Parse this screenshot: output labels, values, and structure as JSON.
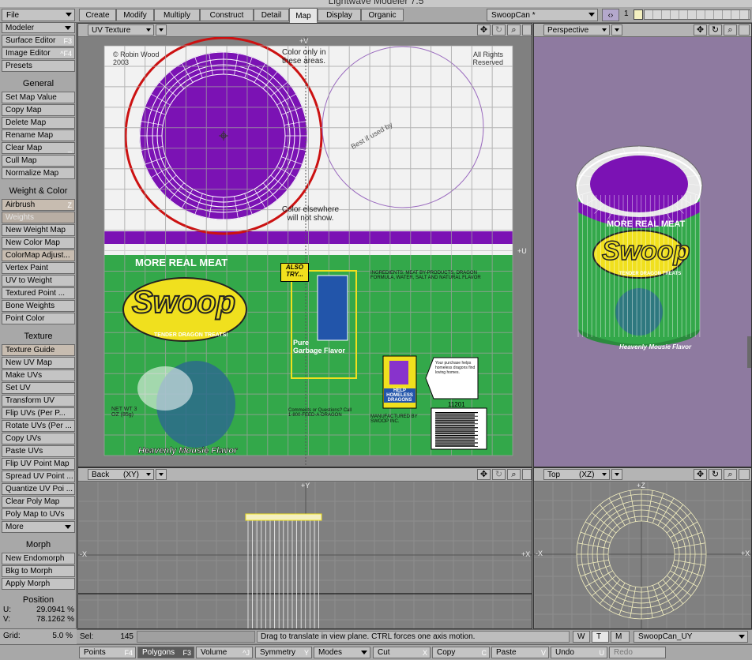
{
  "window": {
    "title": "Lightwave Modeler 7.5"
  },
  "menu": {
    "file": "File"
  },
  "tabs": [
    {
      "label": "Create"
    },
    {
      "label": "Modify"
    },
    {
      "label": "Multiply"
    },
    {
      "label": "Construct"
    },
    {
      "label": "Detail"
    },
    {
      "label": "Map"
    },
    {
      "label": "Display"
    },
    {
      "label": "Organic"
    }
  ],
  "object": {
    "name": "SwoopCan *"
  },
  "layer": {
    "number": "1"
  },
  "sidebar": {
    "mode": "Modeler",
    "top": [
      {
        "label": "Surface Editor",
        "shortcut": "F3"
      },
      {
        "label": "Image Editor",
        "shortcut": "^F4"
      },
      {
        "label": "Presets",
        "shortcut": ""
      }
    ],
    "general_title": "General",
    "general": [
      "Set Map Value",
      "Copy Map",
      "Delete Map",
      "Rename Map",
      "Clear Map",
      "Cull Map",
      "Normalize Map"
    ],
    "weight_title": "Weight & Color",
    "airbrush": {
      "label": "Airbrush",
      "shortcut": "Z"
    },
    "weights": "Weights",
    "weight_items": [
      "New Weight Map",
      "New Color Map",
      "ColorMap Adjust...",
      "Vertex Paint",
      "UV to Weight",
      "Textured Point ...",
      "Bone Weights",
      "Point Color"
    ],
    "texture_title": "Texture",
    "texture_guide": "Texture Guide",
    "texture_items": [
      "New UV Map",
      "Make UVs",
      "Set UV",
      "Transform UV",
      "Flip UVs (Per P...",
      "Rotate UVs (Per ...",
      "Copy UVs",
      "Paste UVs",
      "Flip UV Point Map",
      "Spread UV Point ...",
      "Quantize UV Poi ...",
      "Clear Poly Map",
      "Poly Map to UVs"
    ],
    "more": "More",
    "morph_title": "Morph",
    "morph_items": [
      "New Endomorph",
      "Bkg to Morph",
      "Apply Morph"
    ],
    "position_title": "Position",
    "pos_u_label": "U:",
    "pos_u": "29.0941 %",
    "pos_v_label": "V:",
    "pos_v": "78.1262 %",
    "grid_label": "Grid:",
    "grid": "5.0 %"
  },
  "viewports": {
    "uv": {
      "label": "UV Texture",
      "axis_v": "+V",
      "axis_u": "+U"
    },
    "persp": {
      "label": "Perspective"
    },
    "back": {
      "label": "Back",
      "mode": "(XY)",
      "axis_y": "+Y",
      "axis_x_left": "-X",
      "axis_x_right": "+X"
    },
    "top": {
      "label": "Top",
      "mode": "(XZ)",
      "axis_z": "+Z",
      "axis_x_left": "-X",
      "axis_x_right": "+X"
    }
  },
  "uv_texture": {
    "copyright": "© Robin Wood 2003",
    "rights": "All Rights Reserved",
    "color_only": "Color only in these areas.",
    "color_else": "Color elsewhere will not show.",
    "best_if": "Best if used by",
    "more_real_meat": "MORE REAL MEAT",
    "brand": "Swoop",
    "tagline": "TENDER DRAGON TREATS!",
    "net_wt": "NET WT 3 OZ (85g)",
    "also_try": "ALSO TRY...",
    "pure": "Pure",
    "garbage": "Garbage Flavor",
    "heavenly": "Heavenly Mousie Flavor",
    "help": "HELP HOMELESS DRAGONS",
    "upc": "11201",
    "comments": "Comments or Questions? Call 1-800-FEED-A-DRAGON",
    "manufactured": "MANUFACTURED BY SWOOP INC.",
    "ingredients": "INGREDIENTS: MEAT BY-PRODUCTS, DRAGON FORMULA, WATER, SALT AND NATURAL FLAVOR",
    "tag_text": "Your purchase helps homeless dragons find loving homes."
  },
  "perspective_can": {
    "more_real_meat": "MORE REAL MEAT",
    "brand": "Swoop",
    "tagline": "TENDER DRAGON TREATS",
    "flavor": "Heavenly Mousie Flavor"
  },
  "status": {
    "sel_label": "Sel:",
    "sel_value": "145",
    "message": "Drag to translate in view plane. CTRL forces one axis motion.",
    "w": "W",
    "t": "T",
    "m": "M",
    "map_name": "SwoopCan_UY"
  },
  "bottom": [
    {
      "label": "Points",
      "shortcut": "F4"
    },
    {
      "label": "Polygons",
      "shortcut": "F3"
    },
    {
      "label": "Volume",
      "shortcut": "^J"
    },
    {
      "label": "Symmetry",
      "shortcut": "Y"
    },
    {
      "label": "Modes",
      "shortcut": ""
    },
    {
      "label": "Cut",
      "shortcut": "X"
    },
    {
      "label": "Copy",
      "shortcut": "C"
    },
    {
      "label": "Paste",
      "shortcut": "V"
    },
    {
      "label": "Undo",
      "shortcut": "U"
    },
    {
      "label": "Redo",
      "shortcut": ""
    }
  ],
  "colors": {
    "purple": "#7b12b4",
    "green": "#33a84a",
    "yellow": "#f0e01e",
    "red": "#cc1111",
    "viewport_bg": "#808080",
    "persp_bg": "#8e7aa0"
  }
}
